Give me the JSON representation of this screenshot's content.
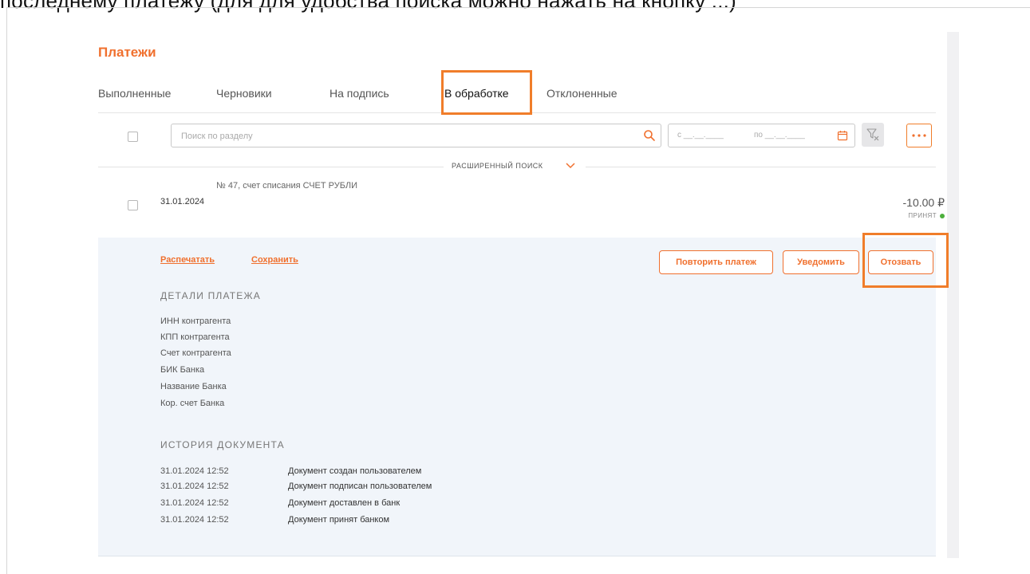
{
  "top_fragment": "последнему платежу (для для удобства поиска можно нажать на кнопку ...)",
  "page_title": "Платежи",
  "tabs": [
    {
      "label": "Выполненные"
    },
    {
      "label": "Черновики"
    },
    {
      "label": "На подпись"
    },
    {
      "label": "В обработке",
      "active": true
    },
    {
      "label": "Отклоненные"
    }
  ],
  "search": {
    "placeholder": "Поиск по разделу"
  },
  "date_range": {
    "from_label": "с __.__.____",
    "to_label": "по __.__.____"
  },
  "advanced_search_label": "РАСШИРЕННЫЙ ПОИСК",
  "payment": {
    "subtitle": "№ 47, счет списания СЧЕТ РУБЛИ",
    "date": "31.01.2024",
    "amount": "-10.00 ₽",
    "status": "ПРИНЯТ",
    "status_color": "#4caf3c"
  },
  "actions": {
    "print": "Распечатать",
    "save": "Сохранить",
    "repeat": "Повторить платеж",
    "notify": "Уведомить",
    "revoke": "Отозвать"
  },
  "details": {
    "title": "ДЕТАЛИ ПЛАТЕЖА",
    "fields": [
      "ИНН контрагента",
      "КПП контрагента",
      "Счет контрагента",
      "БИК Банка",
      "Название Банка",
      "Кор. счет Банка"
    ]
  },
  "history": {
    "title": "ИСТОРИЯ ДОКУМЕНТА",
    "entries": [
      {
        "time": "31.01.2024 12:52",
        "text": "Документ создан пользователем"
      },
      {
        "time": "31.01.2024 12:52",
        "text": "Документ подписан пользователем"
      },
      {
        "time": "31.01.2024 12:52",
        "text": "Документ доставлен в банк"
      },
      {
        "time": "31.01.2024 12:52",
        "text": "Документ принят банком"
      }
    ]
  },
  "colors": {
    "accent": "#f0702e",
    "highlight": "#f07d2a",
    "details_bg": "#f1f5fa"
  }
}
